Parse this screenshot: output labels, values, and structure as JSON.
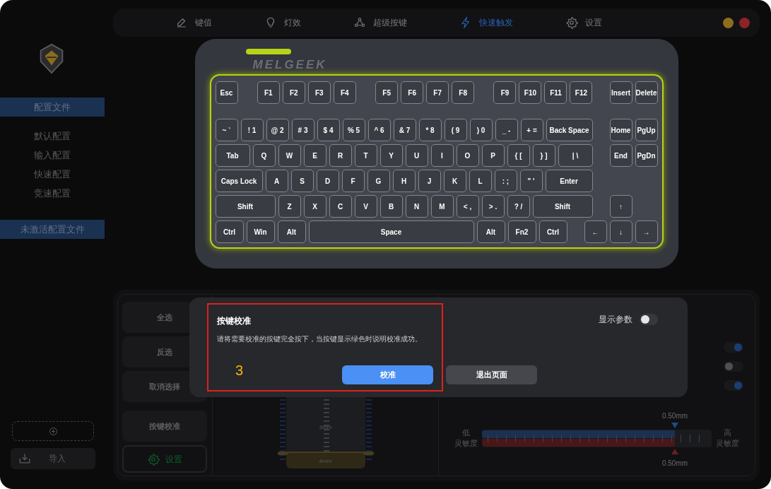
{
  "window_controls": [
    {
      "color": "#8f6d1d"
    },
    {
      "color": "#8e2327"
    }
  ],
  "nav": {
    "tabs": [
      {
        "label": "键值",
        "kind": "keys",
        "selected": false
      },
      {
        "label": "灯效",
        "kind": "light",
        "selected": false
      },
      {
        "label": "超级按键",
        "kind": "super",
        "selected": false
      },
      {
        "label": "快速触发",
        "kind": "trigger",
        "selected": true
      },
      {
        "label": "设置",
        "kind": "settings",
        "selected": false
      }
    ]
  },
  "sidebar": {
    "sections": [
      {
        "title": "配置文件",
        "items": [
          "默认配置",
          "输入配置",
          "快速配置",
          "竞速配置"
        ]
      },
      {
        "title": "未激活配置文件"
      }
    ],
    "import_button": "导入"
  },
  "keyboard": {
    "brand": "MELGEEK",
    "rows": [
      {
        "main": [
          [
            {
              "label": "Esc",
              "kind": "unit"
            }
          ],
          [
            {
              "label": "F1",
              "kind": "unit"
            },
            {
              "label": "F2",
              "kind": "unit"
            },
            {
              "label": "F3",
              "kind": "unit"
            },
            {
              "label": "F4",
              "kind": "unit"
            }
          ],
          [
            {
              "label": "F5",
              "kind": "unit"
            },
            {
              "label": "F6",
              "kind": "unit"
            },
            {
              "label": "F7",
              "kind": "unit"
            },
            {
              "label": "F8",
              "kind": "unit"
            }
          ],
          [
            {
              "label": "F9",
              "kind": "unit"
            },
            {
              "label": "F10",
              "kind": "unit"
            },
            {
              "label": "F11",
              "kind": "unit"
            },
            {
              "label": "F12",
              "kind": "unit"
            }
          ]
        ],
        "side": [
          {
            "label": "Insert",
            "kind": "unit"
          },
          {
            "label": "Delete",
            "kind": "unit"
          }
        ]
      },
      {
        "main": [
          [
            {
              "label": "~ `",
              "kind": "unit"
            },
            {
              "label": "! 1",
              "kind": "unit"
            },
            {
              "label": "@ 2",
              "kind": "unit"
            },
            {
              "label": "# 3",
              "kind": "unit"
            },
            {
              "label": "$ 4",
              "kind": "unit"
            },
            {
              "label": "% 5",
              "kind": "unit"
            },
            {
              "label": "^ 6",
              "kind": "unit"
            },
            {
              "label": "& 7",
              "kind": "unit"
            },
            {
              "label": "* 8",
              "kind": "unit"
            },
            {
              "label": "( 9",
              "kind": "unit"
            },
            {
              "label": ") 0",
              "kind": "unit"
            },
            {
              "label": "_ -",
              "kind": "unit"
            },
            {
              "label": "+ =",
              "kind": "unit"
            },
            {
              "label": "Back Space",
              "kind": "wide"
            }
          ]
        ],
        "side": [
          {
            "label": "Home",
            "kind": "unit"
          },
          {
            "label": "PgUp",
            "kind": "unit"
          }
        ]
      },
      {
        "main": [
          [
            {
              "label": "Tab",
              "kind": "wide"
            },
            {
              "label": "Q",
              "kind": "unit"
            },
            {
              "label": "W",
              "kind": "unit"
            },
            {
              "label": "E",
              "kind": "unit"
            },
            {
              "label": "R",
              "kind": "unit"
            },
            {
              "label": "T",
              "kind": "unit"
            },
            {
              "label": "Y",
              "kind": "unit"
            },
            {
              "label": "U",
              "kind": "unit"
            },
            {
              "label": "I",
              "kind": "unit"
            },
            {
              "label": "O",
              "kind": "unit"
            },
            {
              "label": "P",
              "kind": "unit"
            },
            {
              "label": "{ [",
              "kind": "unit"
            },
            {
              "label": "} ]",
              "kind": "unit"
            },
            {
              "label": "| \\",
              "kind": "wide"
            }
          ]
        ],
        "side": [
          {
            "label": "End",
            "kind": "unit"
          },
          {
            "label": "PgDn",
            "kind": "unit"
          }
        ]
      },
      {
        "main": [
          [
            {
              "label": "Caps Lock",
              "kind": "wide"
            },
            {
              "label": "A",
              "kind": "unit"
            },
            {
              "label": "S",
              "kind": "unit"
            },
            {
              "label": "D",
              "kind": "unit"
            },
            {
              "label": "F",
              "kind": "unit"
            },
            {
              "label": "G",
              "kind": "unit"
            },
            {
              "label": "H",
              "kind": "unit"
            },
            {
              "label": "J",
              "kind": "unit"
            },
            {
              "label": "K",
              "kind": "unit"
            },
            {
              "label": "L",
              "kind": "unit"
            },
            {
              "label": ": ;",
              "kind": "unit"
            },
            {
              "label": "\" '",
              "kind": "unit"
            },
            {
              "label": "Enter",
              "kind": "wide"
            }
          ]
        ]
      },
      {
        "main": [
          [
            {
              "label": "Shift",
              "kind": "wide"
            },
            {
              "label": "Z",
              "kind": "unit"
            },
            {
              "label": "X",
              "kind": "unit"
            },
            {
              "label": "C",
              "kind": "unit"
            },
            {
              "label": "V",
              "kind": "unit"
            },
            {
              "label": "B",
              "kind": "unit"
            },
            {
              "label": "N",
              "kind": "unit"
            },
            {
              "label": "M",
              "kind": "unit"
            },
            {
              "label": "< ,",
              "kind": "unit"
            },
            {
              "label": "> .",
              "kind": "unit"
            },
            {
              "label": "? /",
              "kind": "unit"
            },
            {
              "label": "Shift",
              "kind": "wide"
            }
          ]
        ],
        "side": [
          {
            "label": "↑",
            "kind": "unit"
          }
        ]
      },
      {
        "main": [
          [
            {
              "label": "Ctrl",
              "kind": "modifier"
            },
            {
              "label": "Win",
              "kind": "modifier"
            },
            {
              "label": "Alt",
              "kind": "modifier"
            },
            {
              "label": "Space",
              "kind": "wide"
            },
            {
              "label": "Alt",
              "kind": "modifier"
            },
            {
              "label": "Fn2",
              "kind": "modifier"
            },
            {
              "label": "Ctrl",
              "kind": "modifier"
            }
          ]
        ],
        "side": [
          {
            "label": "←",
            "kind": "unit"
          },
          {
            "label": "↓",
            "kind": "unit"
          },
          {
            "label": "→",
            "kind": "unit"
          }
        ]
      }
    ]
  },
  "panel": {
    "actions": [
      {
        "label": "全选",
        "kind": "plain"
      },
      {
        "label": "反选",
        "kind": "plain"
      },
      {
        "label": "取消选择",
        "kind": "plain"
      },
      {
        "label": "按键校准",
        "kind": "tool"
      },
      {
        "label": "设置",
        "kind": "settings"
      }
    ],
    "travel_labels": [
      "3mm",
      "4mm"
    ],
    "toggles": [
      {
        "on": true
      },
      {
        "on": false
      },
      {
        "on": true
      }
    ],
    "sensitivity": {
      "low_label": "低",
      "low_caption": "灵敏度",
      "high_label": "高",
      "high_caption": "灵敏度",
      "actuation": {
        "reading": "0.50mm",
        "level": 0.84
      },
      "release": {
        "reading": "0.50mm",
        "level": 0.84
      }
    }
  },
  "modal": {
    "title": "按键校准",
    "message": "请将需要校准的按键完全按下，当按键显示绿色时说明校准成功。",
    "annotation": "3",
    "buttons": [
      {
        "label": "校准",
        "kind": "primary"
      },
      {
        "label": "退出页面",
        "kind": "secondary"
      }
    ],
    "show_params": {
      "label": "显示参数",
      "on": false
    }
  }
}
